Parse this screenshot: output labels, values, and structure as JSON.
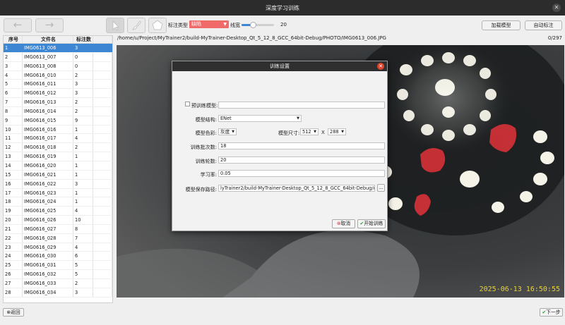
{
  "window": {
    "title": "深度学习训练"
  },
  "toolbar": {
    "back_label": "←",
    "forward_label": "→",
    "annotation_type_label": "标注类型",
    "annotation_type_value": "缺陷",
    "line_width_label": "线宽",
    "line_width_value": "20",
    "line_width_fraction": 0.35,
    "load_model_label": "加载模型",
    "auto_annotate_label": "自动标注"
  },
  "table": {
    "headers": [
      "序号",
      "文件名",
      "标注数"
    ],
    "selected_index": 0,
    "rows": [
      [
        "1",
        "IMG0613_006",
        "3"
      ],
      [
        "2",
        "IMG0613_007",
        "0"
      ],
      [
        "3",
        "IMG0613_008",
        "0"
      ],
      [
        "4",
        "IMG0616_010",
        "2"
      ],
      [
        "5",
        "IMG0616_011",
        "3"
      ],
      [
        "6",
        "IMG0616_012",
        "3"
      ],
      [
        "7",
        "IMG0616_013",
        "2"
      ],
      [
        "8",
        "IMG0616_014",
        "2"
      ],
      [
        "9",
        "IMG0616_015",
        "9"
      ],
      [
        "10",
        "IMG0616_016",
        "1"
      ],
      [
        "11",
        "IMG0616_017",
        "4"
      ],
      [
        "12",
        "IMG0616_018",
        "2"
      ],
      [
        "13",
        "IMG0616_019",
        "1"
      ],
      [
        "14",
        "IMG0616_020",
        "1"
      ],
      [
        "15",
        "IMG0616_021",
        "1"
      ],
      [
        "16",
        "IMG0616_022",
        "3"
      ],
      [
        "17",
        "IMG0616_023",
        "1"
      ],
      [
        "18",
        "IMG0616_024",
        "1"
      ],
      [
        "19",
        "IMG0616_025",
        "4"
      ],
      [
        "20",
        "IMG0616_026",
        "10"
      ],
      [
        "21",
        "IMG0616_027",
        "8"
      ],
      [
        "22",
        "IMG0616_028",
        "7"
      ],
      [
        "23",
        "IMG0616_029",
        "4"
      ],
      [
        "24",
        "IMG0616_030",
        "6"
      ],
      [
        "25",
        "IMG0616_031",
        "5"
      ],
      [
        "26",
        "IMG0616_032",
        "5"
      ],
      [
        "27",
        "IMG0616_033",
        "2"
      ],
      [
        "28",
        "IMG0616_034",
        "3"
      ]
    ]
  },
  "viewer": {
    "path": "/home/u/Project/MyTrainer2/build-MyTrainer-Desktop_Qt_5_12_8_GCC_64bit-Debug/PHOTO/IMG0613_006.JPG",
    "page_count": "0/297",
    "timestamp": "2025-06-13  16:50:55"
  },
  "dialog": {
    "title": "训练设置",
    "pretrained_label": "预训练模型:",
    "pretrained_value": "",
    "structure_label": "模型结构:",
    "structure_value": "ENet",
    "color_label": "模型色彩:",
    "color_value": "灰度",
    "size_label": "模型尺寸:",
    "size_w": "512",
    "size_x": "X",
    "size_h": "288",
    "batch_label": "训练批次数:",
    "batch_value": "18",
    "epochs_label": "训练轮数:",
    "epochs_value": "20",
    "lr_label": "学习率:",
    "lr_value": "0.05",
    "save_path_label": "模型保存路径:",
    "save_path_value": "lyTrainer2/build-MyTrainer-Desktop_Qt_5_12_8_GCC_64bit-Debug/output",
    "browse_label": "...",
    "cancel_label": "取消",
    "start_label": "开始训练"
  },
  "footer": {
    "back_label": "返回",
    "next_label": "下一步"
  },
  "colors": {
    "selection": "#3d86d4",
    "annotation": "#e2323a",
    "type_select": "#f06a6a",
    "timestamp": "#e8d23a"
  }
}
